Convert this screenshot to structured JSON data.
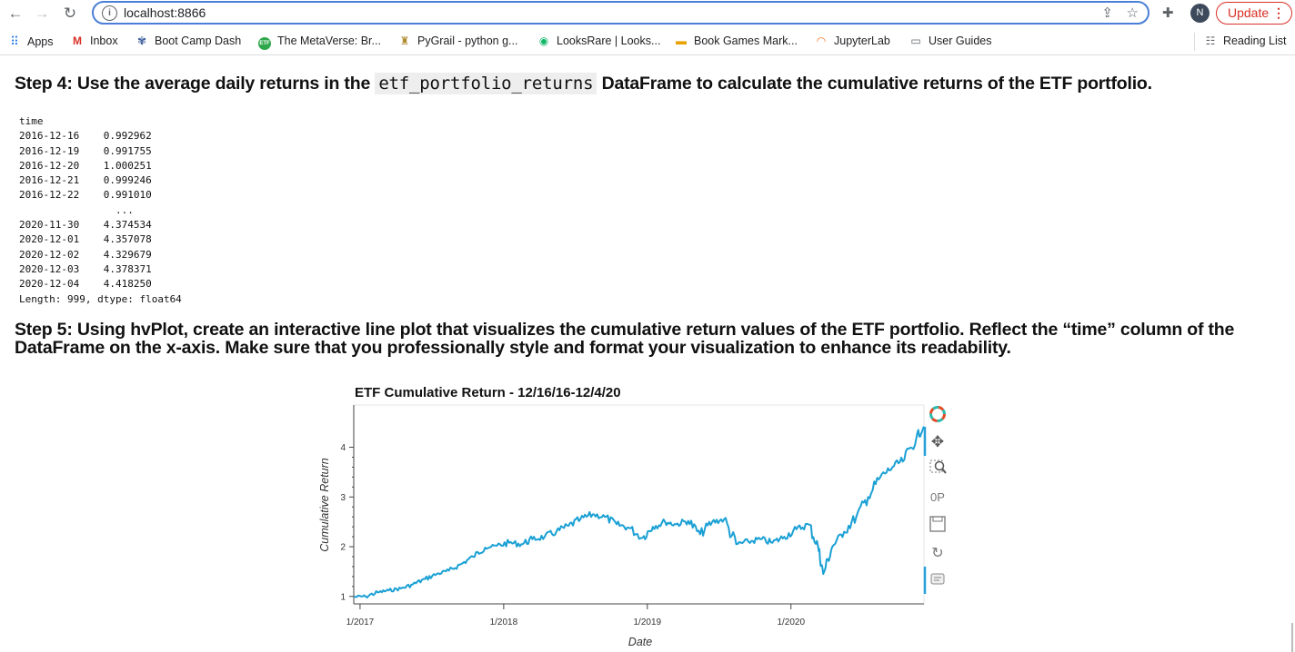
{
  "browser": {
    "url": "localhost:8866",
    "update_label": "Update",
    "avatar_letter": "N"
  },
  "bookmarks": [
    {
      "label": "Apps",
      "icon": "apps-grid-icon"
    },
    {
      "label": "Inbox",
      "icon": "gmail-icon"
    },
    {
      "label": "Boot Camp Dash",
      "icon": "bootcamp-icon"
    },
    {
      "label": "The MetaVerse: Br...",
      "icon": "etf-icon"
    },
    {
      "label": "PyGrail - python g...",
      "icon": "grail-icon"
    },
    {
      "label": "LooksRare | Looks...",
      "icon": "eye-icon"
    },
    {
      "label": "Book Games Mark...",
      "icon": "book-games-icon"
    },
    {
      "label": "JupyterLab",
      "icon": "jupyter-icon"
    },
    {
      "label": "User Guides",
      "icon": "folder-icon"
    },
    {
      "label": "Reading List",
      "icon": "reading-list-icon"
    }
  ],
  "step4": {
    "prefix": "Step 4: Use the average daily returns in the",
    "code": "etf_portfolio_returns",
    "suffix": "DataFrame to calculate the cumulative returns of the ETF portfolio."
  },
  "series_output": {
    "text": "time\n2016-12-16    0.992962\n2016-12-19    0.991755\n2016-12-20    1.000251\n2016-12-21    0.999246\n2016-12-22    0.991010\n                ...   \n2020-11-30    4.374534\n2020-12-01    4.357078\n2020-12-02    4.329679\n2020-12-03    4.378371\n2020-12-04    4.418250\nLength: 999, dtype: float64"
  },
  "step5": {
    "line1": "Step 5: Using hvPlot, create an interactive line plot that visualizes the cumulative return values of the ETF portfolio. Reflect the “time” column of the",
    "line2": "DataFrame on the x-axis. Make sure that you professionally style and format your visualization to enhance its readability."
  },
  "colors": {
    "line": "#1aa0d4",
    "toolbar_active": "#26a0da"
  },
  "toolbar": [
    "bokeh-logo-icon",
    "pan-icon",
    "box-zoom-icon",
    "wheel-zoom-icon",
    "save-icon",
    "reset-icon",
    "hover-icon"
  ],
  "chart_data": {
    "type": "line",
    "title": "ETF Cumulative Return - 12/16/16-12/4/20",
    "xlabel": "Date",
    "ylabel": "Cumulative Return",
    "xlim": [
      "2016-12-16",
      "2020-12-04"
    ],
    "ylim": [
      0.85,
      4.85
    ],
    "yticks": [
      1,
      2,
      3,
      4
    ],
    "xticks": [
      "1/2017",
      "1/2018",
      "1/2019",
      "1/2020"
    ],
    "grid": false,
    "series": [
      {
        "x": [
          "2016-12-16",
          "2017-01-15",
          "2017-02-15",
          "2017-03-15",
          "2017-04-15",
          "2017-05-15",
          "2017-06-15",
          "2017-07-15",
          "2017-08-15",
          "2017-09-15",
          "2017-10-15",
          "2017-11-15",
          "2017-12-15",
          "2018-01-15",
          "2018-02-15",
          "2018-03-15",
          "2018-04-15",
          "2018-05-15",
          "2018-06-15",
          "2018-07-15",
          "2018-08-15",
          "2018-09-15",
          "2018-10-15",
          "2018-11-15",
          "2018-12-20",
          "2019-01-15",
          "2019-02-15",
          "2019-03-15",
          "2019-04-15",
          "2019-05-15",
          "2019-06-15",
          "2019-07-15",
          "2019-08-15",
          "2019-09-15",
          "2019-10-15",
          "2019-11-15",
          "2019-12-15",
          "2020-01-15",
          "2020-02-15",
          "2020-03-10",
          "2020-03-23",
          "2020-04-15",
          "2020-05-15",
          "2020-06-15",
          "2020-07-15",
          "2020-08-15",
          "2020-09-15",
          "2020-10-15",
          "2020-11-15",
          "2020-12-04"
        ],
        "y": [
          0.99,
          1.0,
          1.08,
          1.12,
          1.16,
          1.24,
          1.35,
          1.45,
          1.52,
          1.65,
          1.8,
          1.98,
          2.02,
          2.08,
          2.05,
          2.15,
          2.2,
          2.3,
          2.42,
          2.55,
          2.65,
          2.6,
          2.45,
          2.38,
          2.18,
          2.4,
          2.5,
          2.45,
          2.52,
          2.25,
          2.5,
          2.55,
          2.05,
          2.1,
          2.15,
          2.08,
          2.2,
          2.35,
          2.45,
          2.0,
          1.45,
          2.0,
          2.3,
          2.6,
          3.0,
          3.4,
          3.6,
          3.75,
          4.2,
          4.418
        ]
      }
    ]
  }
}
